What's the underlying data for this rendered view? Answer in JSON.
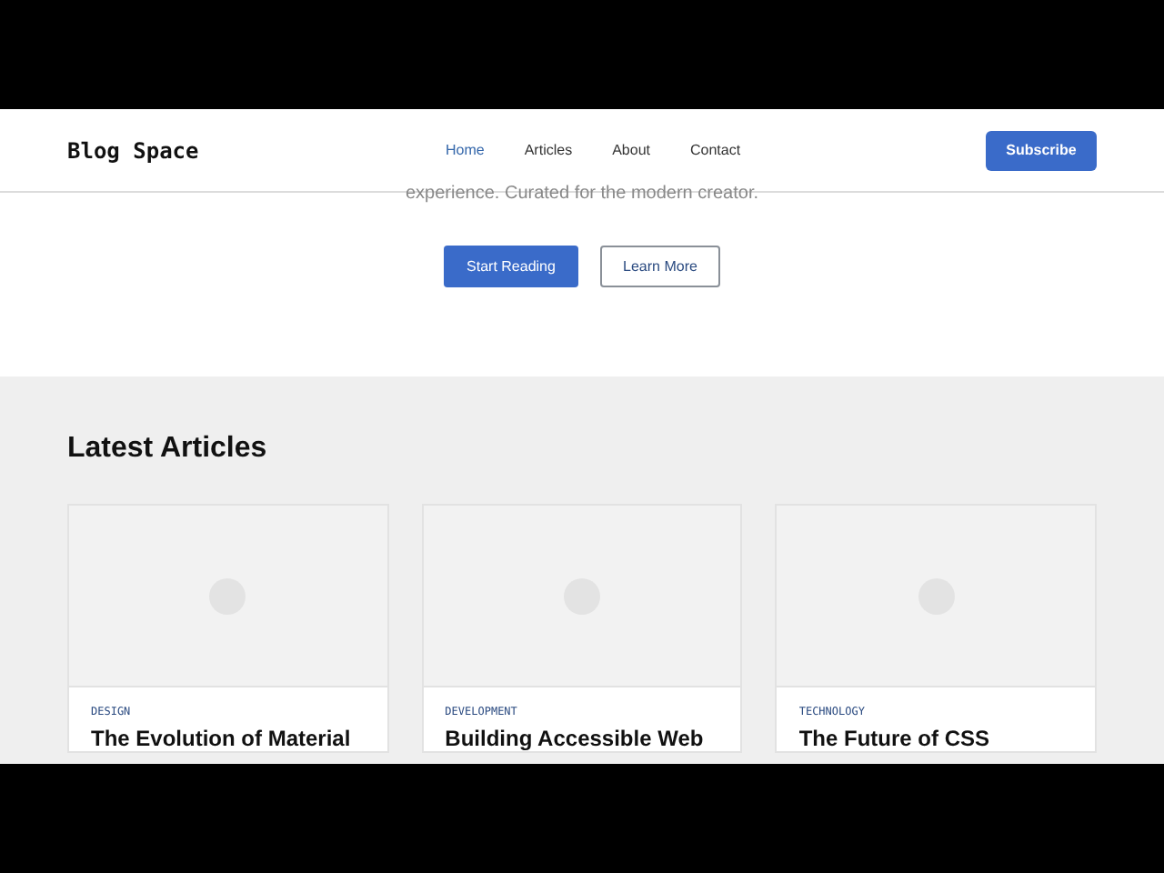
{
  "header": {
    "logo": "Blog Space",
    "nav": [
      {
        "label": "Home",
        "selected": true
      },
      {
        "label": "Articles",
        "selected": false
      },
      {
        "label": "About",
        "selected": false
      },
      {
        "label": "Contact",
        "selected": false
      }
    ],
    "cta": "Subscribe"
  },
  "hero": {
    "subtitle": "experience. Curated for the modern creator.",
    "buttons": [
      {
        "label": "Start Reading",
        "kind": "primary"
      },
      {
        "label": "Learn More",
        "kind": "outline"
      }
    ]
  },
  "articles": {
    "heading": "Latest Articles",
    "cards": [
      {
        "category": "DESIGN",
        "title": "The Evolution of Material"
      },
      {
        "category": "DEVELOPMENT",
        "title": "Building Accessible Web"
      },
      {
        "category": "TECHNOLOGY",
        "title": "The Future of CSS"
      }
    ]
  }
}
